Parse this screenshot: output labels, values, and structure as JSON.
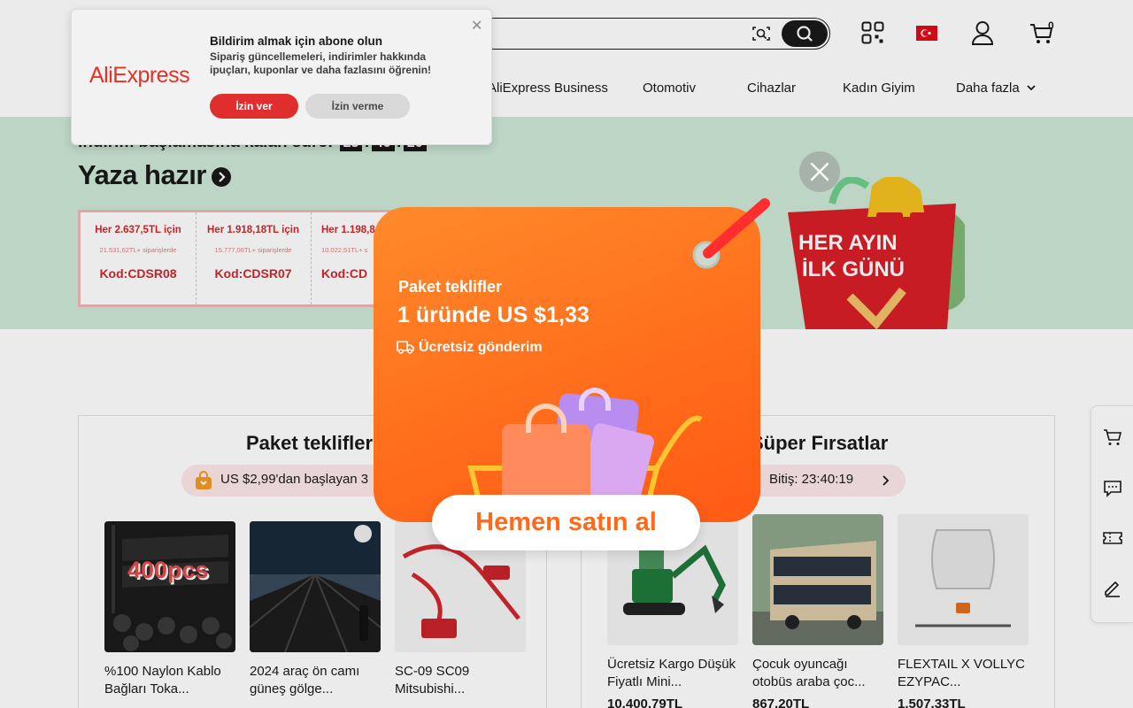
{
  "header": {
    "cart_count": "0",
    "nav": [
      "AliExpress Business",
      "Otomotiv",
      "Cihazlar",
      "Kadın Giyim",
      "Daha fazla"
    ]
  },
  "banner": {
    "countdown_label": "İndirim başlamasına kalan süre:",
    "countdown": [
      "23",
      "40",
      "20"
    ],
    "title": "Yaza hazır",
    "coupons": [
      {
        "title": "Her 2.637,5TL için",
        "sub": "21.531,62TL+ siparişlerde",
        "code": "Kod:CDSR08"
      },
      {
        "title": "Her 1.918,18TL için",
        "sub": "15.777,06TL+ siparişlerde",
        "code": "Kod:CDSR07"
      },
      {
        "title": "Her 1.198,8",
        "sub": "10.022,51TL+ s",
        "code": "Kod:CD"
      }
    ],
    "bag_line1": "HER AYIN",
    "bag_line2": "İLK GÜNÜ"
  },
  "sections": {
    "bundle": {
      "title": "Paket teklifler",
      "pill": "US $2,99'dan başlayan 3",
      "products": [
        {
          "name": "%100 Naylon Kablo Bağları Toka...",
          "overlay": "400pcs"
        },
        {
          "name": "2024 araç ön camı güneş gölge..."
        },
        {
          "name": "SC-09 SC09 Mitsubishi..."
        }
      ]
    },
    "super": {
      "title": "Süper Fırsatlar",
      "pill": "Bitiş: 23:40:19",
      "products": [
        {
          "name": "Ücretsiz Kargo Düşük Fiyatlı Mini...",
          "price": "10.400,79TL"
        },
        {
          "name": "Çocuk oyuncağı otobüs araba çoc...",
          "price": "867,20TL"
        },
        {
          "name": "FLEXTAIL X VOLLYC EZYPAC...",
          "price": "1.507,33TL"
        }
      ]
    }
  },
  "notification": {
    "logo": "AliExpress",
    "title": "Bildirim almak için abone olun",
    "desc": "Sipariş güncellemeleri, indirimler hakkında ipuçları, kuponlar ve daha fazlasını öğrenin!",
    "allow": "İzin ver",
    "deny": "İzin verme"
  },
  "promo": {
    "line1": "Paket teklifler",
    "line2": "1 üründe US $1,33",
    "line3": "Ücretsiz gönderim",
    "button": "Hemen satın al"
  },
  "colors": {
    "brand_red": "#e43225",
    "promo_orange": "#ff6a1a",
    "banner_green": "#cde8d5"
  }
}
